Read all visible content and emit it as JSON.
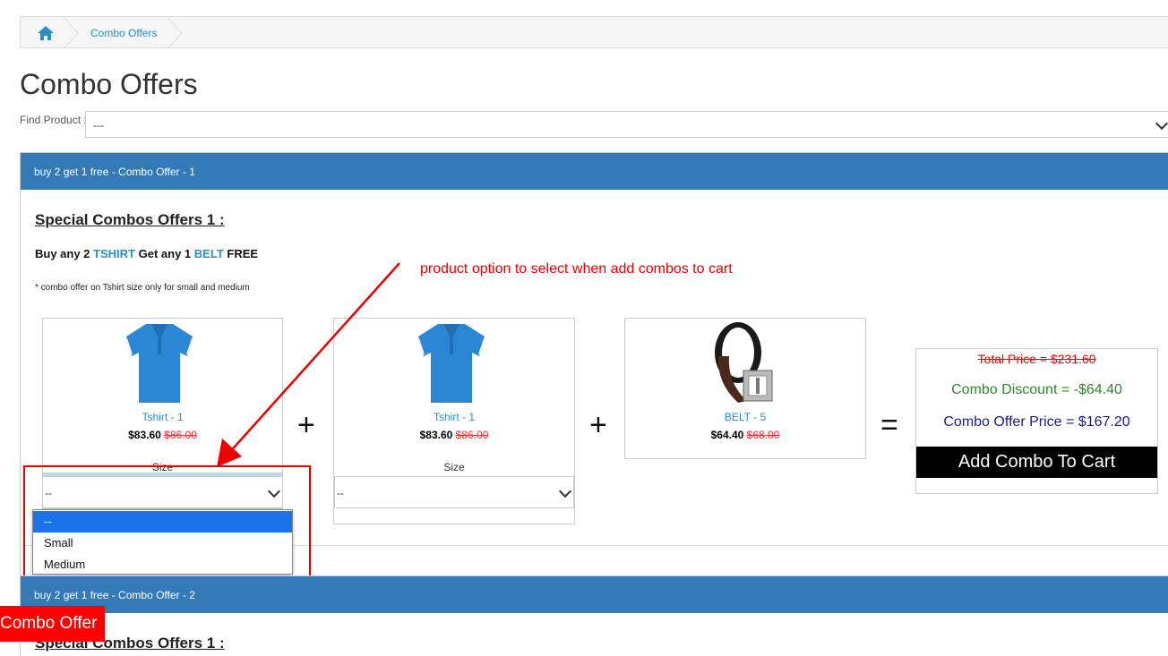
{
  "breadcrumb": {
    "home_icon": "home-icon",
    "item": "Combo Offers"
  },
  "page": {
    "title": "Combo Offers"
  },
  "find": {
    "label": "Find Product :",
    "value": "---"
  },
  "offer1": {
    "header": "buy 2 get 1 free - Combo Offer - 1",
    "title": "Special Combos Offers 1 :",
    "buy_prefix": "Buy any 2",
    "buy_item": "TSHIRT",
    "get_prefix": "Get any 1",
    "get_item": "BELT",
    "free": "FREE",
    "note": "* combo offer on Tshirt size only for small and medium",
    "products": [
      {
        "name": "Tshirt - 1",
        "price": "$83.60",
        "old_price": "$86.00",
        "size_label": "Size",
        "size_value": "--"
      },
      {
        "name": "Tshirt - 1",
        "price": "$83.60",
        "old_price": "$86.00",
        "size_label": "Size",
        "size_value": "--"
      },
      {
        "name": "BELT - 5",
        "price": "$64.40",
        "old_price": "$68.00"
      }
    ],
    "plus": "+",
    "equals": "=",
    "summary": {
      "total": "Total Price = $231.60",
      "discount": "Combo Discount = -$64.40",
      "offer_price": "Combo Offer Price = $167.20",
      "add_button": "Add Combo To Cart"
    },
    "dropdown_options": [
      "--",
      "Small",
      "Medium"
    ]
  },
  "annotation": "product option to select when add combos to cart",
  "offer2": {
    "header": "buy 2 get 1 free - Combo Offer - 2",
    "title": "Special Combos Offers 1 :"
  },
  "combo_tag": "Combo Offer",
  "colors": {
    "header_blue": "#337ab7",
    "link_blue": "#2a8fc4",
    "annotation_red": "#ee0000",
    "discount_green": "#2a8a2a"
  }
}
